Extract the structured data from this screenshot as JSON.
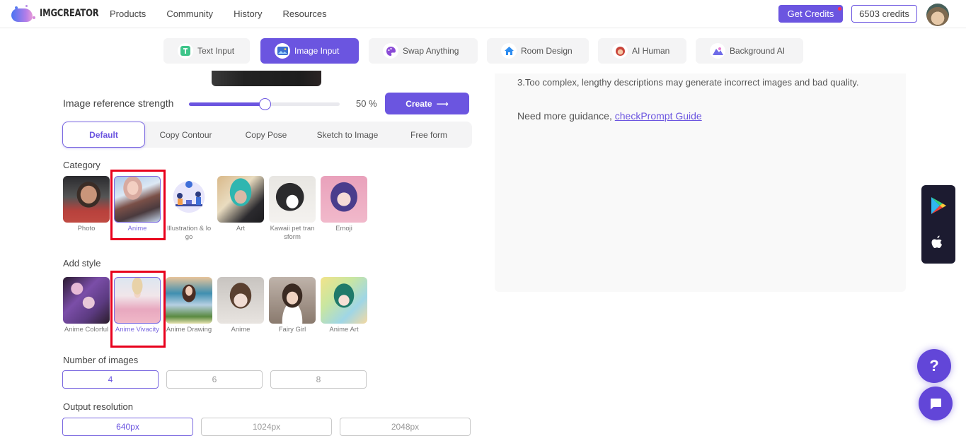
{
  "header": {
    "brand": "IMGCREATOR",
    "nav": [
      "Products",
      "Community",
      "History",
      "Resources"
    ],
    "get_credits_label": "Get Credits",
    "credits_label": "6503 credits"
  },
  "tabs": [
    {
      "label": "Text Input",
      "icon": "text-input-icon",
      "active": false
    },
    {
      "label": "Image Input",
      "icon": "image-input-icon",
      "active": true
    },
    {
      "label": "Swap Anything",
      "icon": "palette-icon",
      "active": false
    },
    {
      "label": "Room Design",
      "icon": "house-icon",
      "active": false
    },
    {
      "label": "AI Human",
      "icon": "ai-human-icon",
      "active": false
    },
    {
      "label": "Background AI",
      "icon": "background-ai-icon",
      "active": false
    }
  ],
  "reference": {
    "strength_label": "Image reference strength",
    "strength_value": 50,
    "strength_display": "50 %",
    "create_label": "Create",
    "create_arrow": "⟶"
  },
  "modes": [
    {
      "label": "Default",
      "active": true
    },
    {
      "label": "Copy Contour",
      "active": false
    },
    {
      "label": "Copy Pose",
      "active": false
    },
    {
      "label": "Sketch to Image",
      "active": false
    },
    {
      "label": "Free form",
      "active": false
    }
  ],
  "category": {
    "label": "Category",
    "items": [
      {
        "label": "Photo",
        "selected": false
      },
      {
        "label": "Anime",
        "selected": true
      },
      {
        "label": "Illustration & logo",
        "selected": false
      },
      {
        "label": "Art",
        "selected": false
      },
      {
        "label": "Kawaii pet transform",
        "selected": false
      },
      {
        "label": "Emoji",
        "selected": false
      }
    ]
  },
  "style": {
    "label": "Add style",
    "items": [
      {
        "label": "Anime Colorful",
        "selected": false
      },
      {
        "label": "Anime Vivacity",
        "selected": true
      },
      {
        "label": "Anime Drawing",
        "selected": false
      },
      {
        "label": "Anime",
        "selected": false
      },
      {
        "label": "Fairy Girl",
        "selected": false
      },
      {
        "label": "Anime Art",
        "selected": false
      }
    ]
  },
  "num_images": {
    "label": "Number of images",
    "options": [
      {
        "label": "4",
        "active": true
      },
      {
        "label": "6",
        "active": false
      },
      {
        "label": "8",
        "active": false
      }
    ]
  },
  "resolution": {
    "label": "Output resolution",
    "options": [
      {
        "label": "640px",
        "active": true
      },
      {
        "label": "1024px",
        "active": false
      },
      {
        "label": "2048px",
        "active": false
      }
    ]
  },
  "tips": {
    "text": "3.Too complex, lengthy descriptions may generate incorrect images and bad quality.",
    "guide_prefix": "Need more guidance, ",
    "guide_link": "checkPrompt Guide"
  },
  "floating": {
    "help_label": "?"
  },
  "colors": {
    "accent": "#6b55e0",
    "highlight": "#e8001c",
    "app_badge_bg": "#1c1b30"
  }
}
